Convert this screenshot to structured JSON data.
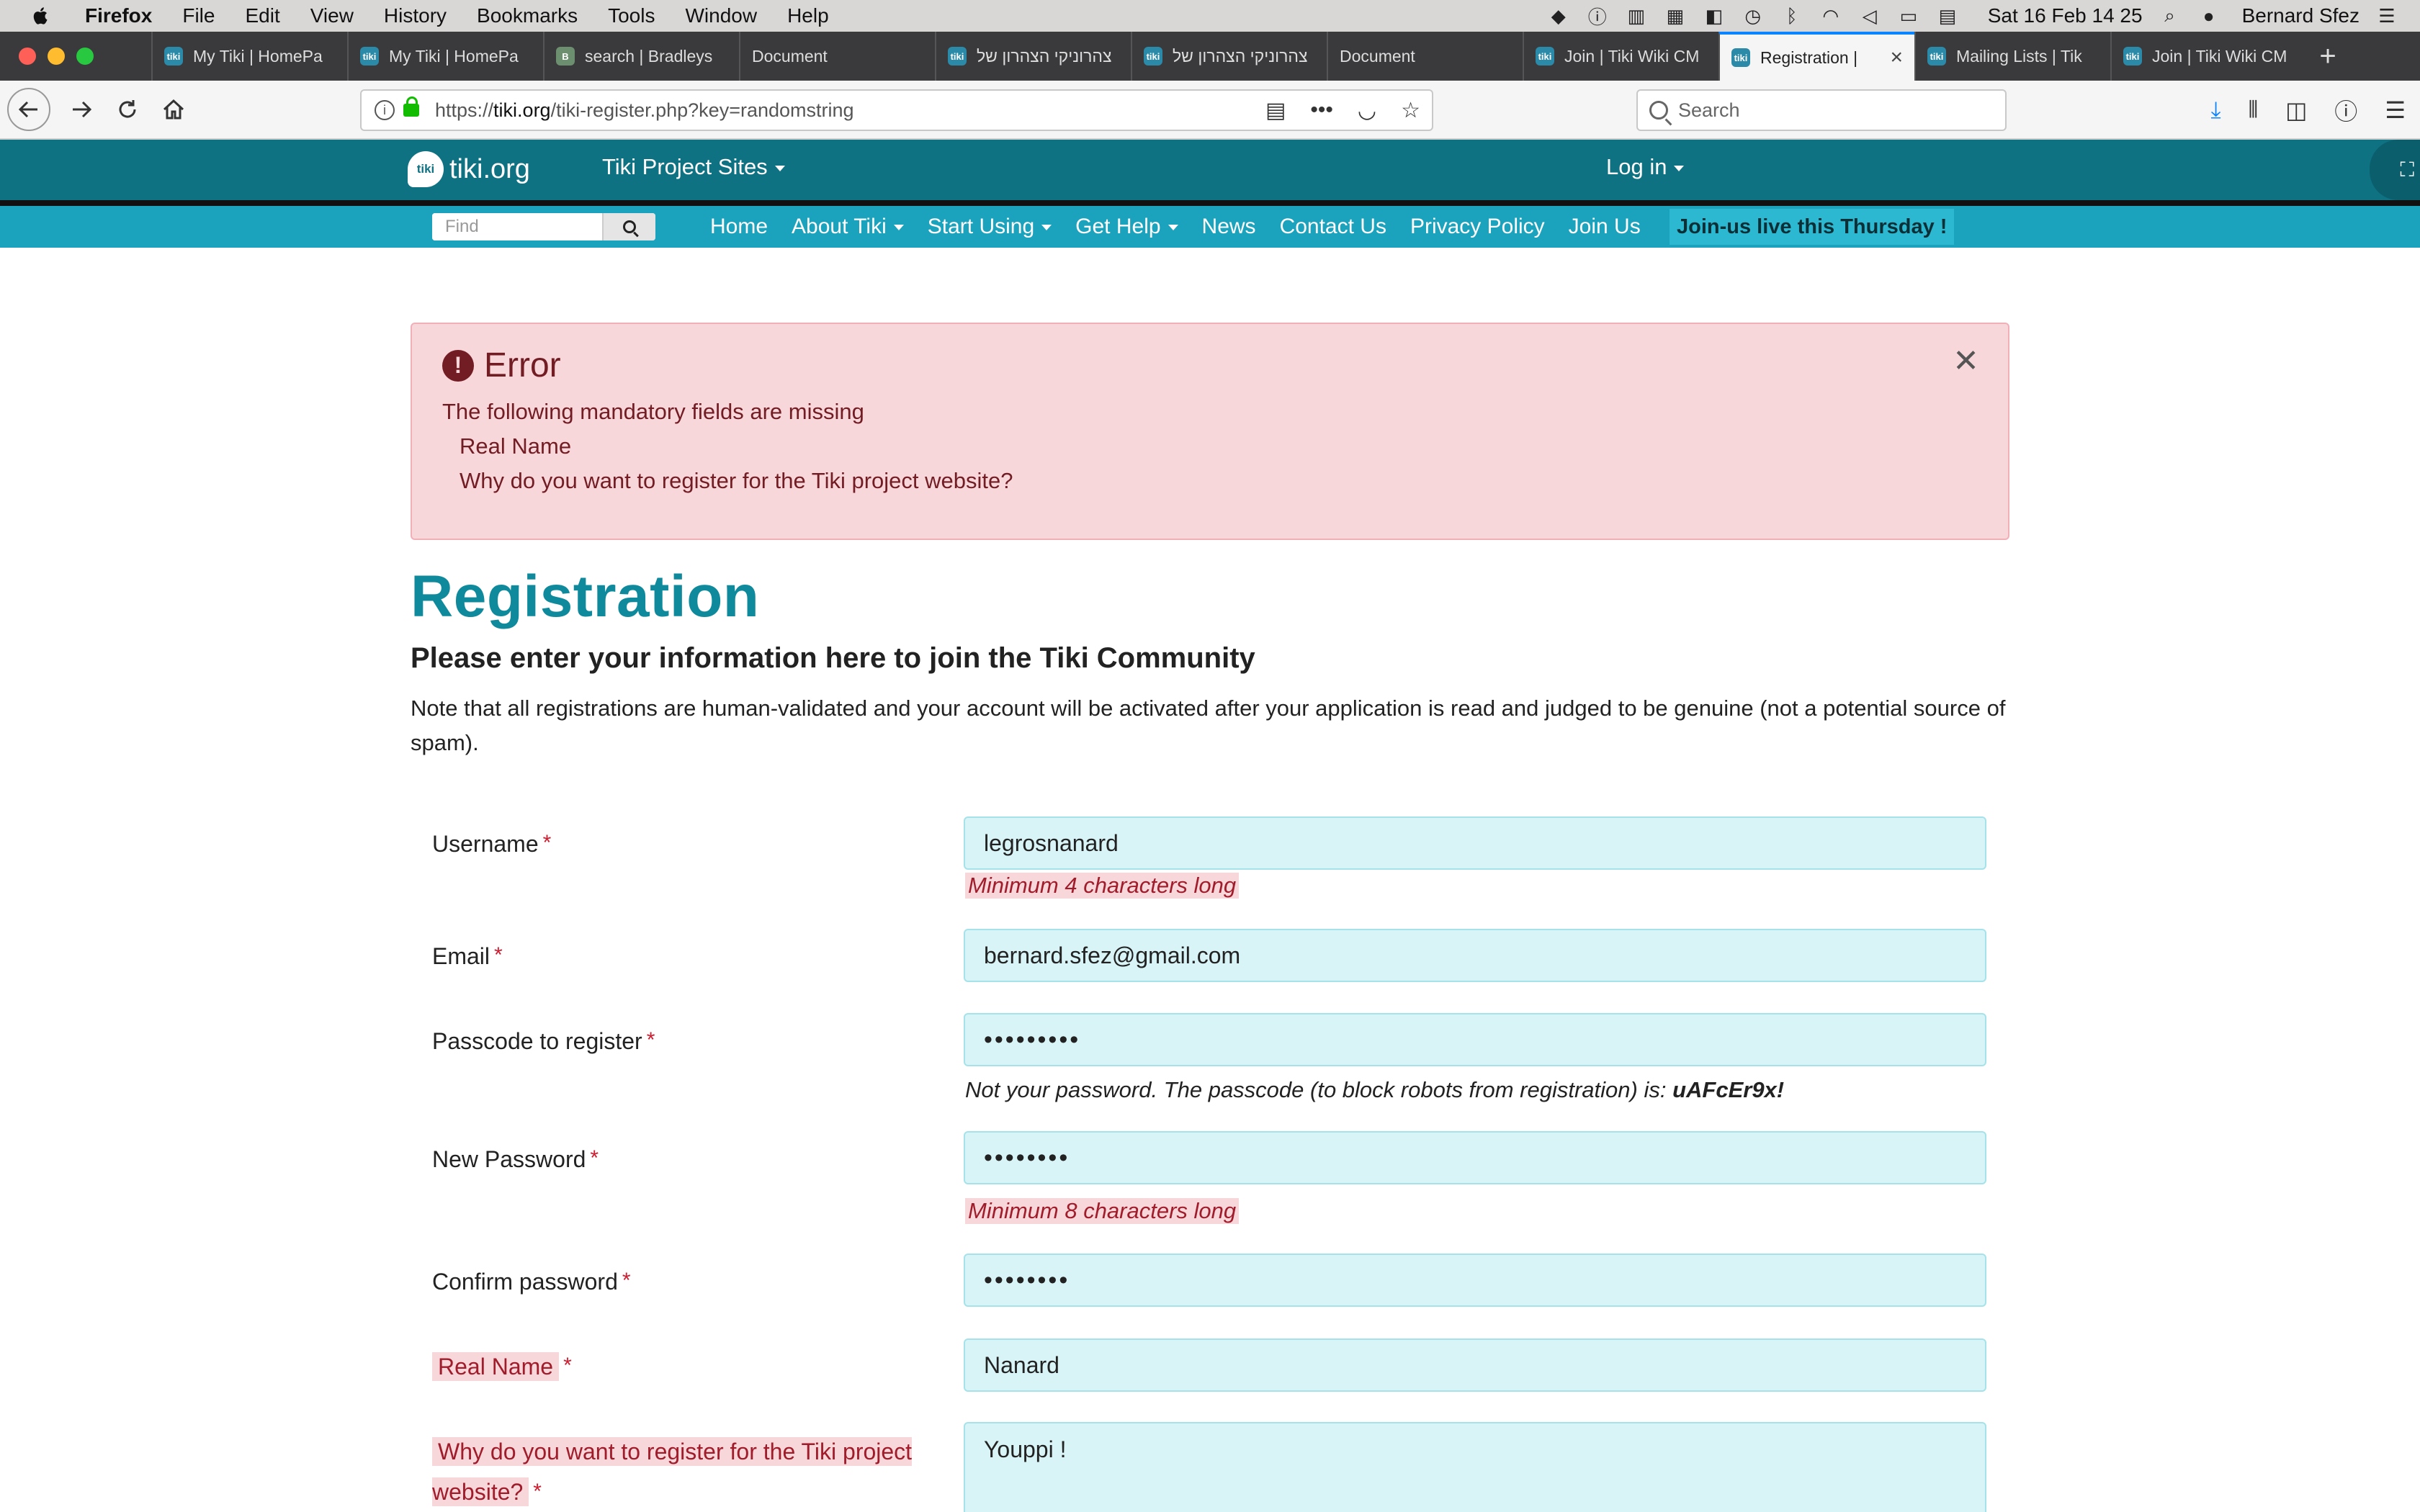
{
  "menubar": {
    "app": "Firefox",
    "items": [
      "File",
      "Edit",
      "View",
      "History",
      "Bookmarks",
      "Tools",
      "Window",
      "Help"
    ],
    "clock": "Sat 16 Feb  14 25",
    "user": "Bernard Sfez"
  },
  "tabs": [
    {
      "label": "My Tiki | HomePa",
      "favicon": "tiki"
    },
    {
      "label": "My Tiki | HomePa",
      "favicon": "tiki"
    },
    {
      "label": "search | Bradleys",
      "favicon": "alt"
    },
    {
      "label": "Document",
      "favicon": "none"
    },
    {
      "label": "צהרוניקי הצהרון של",
      "favicon": "tiki"
    },
    {
      "label": "צהרוניקי הצהרון של",
      "favicon": "tiki"
    },
    {
      "label": "Document",
      "favicon": "none"
    },
    {
      "label": "Join | Tiki Wiki CM",
      "favicon": "tiki"
    },
    {
      "label": "Registration |",
      "favicon": "tiki",
      "active": true
    },
    {
      "label": "Mailing Lists | Tik",
      "favicon": "tiki"
    },
    {
      "label": "Join | Tiki Wiki CM",
      "favicon": "tiki"
    }
  ],
  "urlbar": {
    "prefix": "https://",
    "domain": "tiki.org",
    "path": "/tiki-register.php?key=randomstring"
  },
  "searchbar": {
    "placeholder": "Search"
  },
  "site": {
    "logo": "tiki.org",
    "logo_mark": "tiki",
    "project_sites": "Tiki Project Sites",
    "login": "Log in",
    "find_placeholder": "Find",
    "nav": [
      {
        "label": "Home",
        "dropdown": false
      },
      {
        "label": "About Tiki",
        "dropdown": true
      },
      {
        "label": "Start Using",
        "dropdown": true
      },
      {
        "label": "Get Help",
        "dropdown": true
      },
      {
        "label": "News",
        "dropdown": false
      },
      {
        "label": "Contact Us",
        "dropdown": false
      },
      {
        "label": "Privacy Policy",
        "dropdown": false
      },
      {
        "label": "Join Us",
        "dropdown": false
      }
    ],
    "promo": "Join-us live this Thursday !"
  },
  "error": {
    "title": "Error",
    "message": "The following mandatory fields are missing",
    "items": [
      "Real Name",
      "Why do you want to register for the Tiki project website?"
    ]
  },
  "registration": {
    "title": "Registration",
    "subtitle": "Please enter your information here to join the Tiki Community",
    "note": "Note that all registrations are human-validated and your account will be activated after your application is read and judged to be genuine (not a potential source of spam).",
    "fields": {
      "username": {
        "label": "Username",
        "value": "legrosnanard",
        "hint": "Minimum 4 characters long"
      },
      "email": {
        "label": "Email",
        "value": "bernard.sfez@gmail.com"
      },
      "passcode": {
        "label": "Passcode to register",
        "value": "•••••••••",
        "hint_prefix": "Not your password. The passcode (to block robots from registration) is: ",
        "hint_code": "uAFcEr9x!"
      },
      "new_password": {
        "label": "New Password",
        "value": "••••••••",
        "hint": "Minimum 8 characters long"
      },
      "confirm_password": {
        "label": "Confirm password",
        "value": "••••••••"
      },
      "real_name": {
        "label": "Real Name",
        "value": "Nanard"
      },
      "why": {
        "label": "Why do you want to register for the Tiki project website?",
        "value": "Youppi !"
      }
    },
    "required_mark": "*"
  },
  "colors": {
    "header": "#0f7283",
    "subnav": "#1ba2bc",
    "title": "#0f8a9c",
    "error_bg": "#f8d7da",
    "error_text": "#721c24",
    "field_bg": "#d9f4f7",
    "tab_active_accent": "#0a84ff"
  }
}
